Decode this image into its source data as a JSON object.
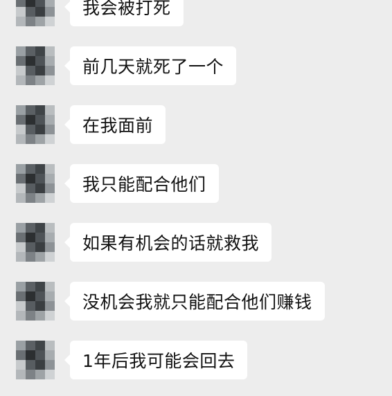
{
  "conversation": {
    "messages": [
      {
        "text": "我会被打死"
      },
      {
        "text": "前几天就死了一个"
      },
      {
        "text": "在我面前"
      },
      {
        "text": "我只能配合他们"
      },
      {
        "text": "如果有机会的话就救我"
      },
      {
        "text": "没机会我就只能配合他们赚钱"
      },
      {
        "text": "1年后我可能会回去"
      }
    ]
  },
  "colors": {
    "background": "#ededed",
    "bubble": "#ffffff",
    "text": "#111111"
  },
  "icons": {
    "avatar": "pixelated-avatar"
  }
}
